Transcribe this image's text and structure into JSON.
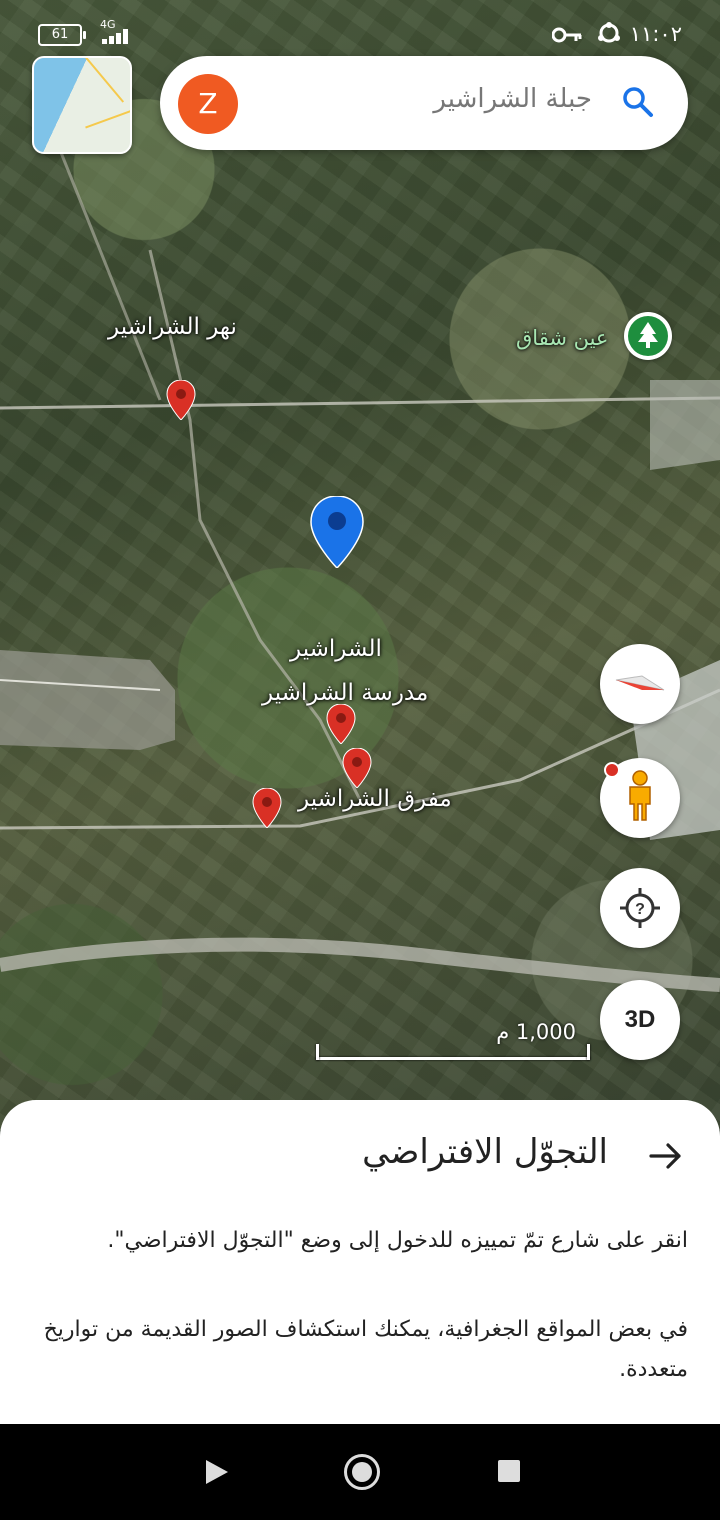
{
  "status_bar": {
    "battery": "61",
    "network": "4G",
    "time": "١١:٠٢"
  },
  "search": {
    "avatar_letter": "Z",
    "query": "جبلة الشراشير"
  },
  "map_labels": {
    "river": "نهر الشراشير",
    "spring": "عين شقاق",
    "village": "الشراشير",
    "school": "مدرسة الشراشير",
    "junction": "مفرق الشراشير"
  },
  "controls": {
    "mode_3d": "3D"
  },
  "scale": {
    "label": "1,000 م"
  },
  "sheet": {
    "title": "التجوّل الافتراضي",
    "paragraph1": "انقر على شارع تمّ تمييزه للدخول إلى وضع \"التجوّل الافتراضي\".",
    "paragraph2": "في بعض المواقع الجغرافية، يمكنك استكشاف الصور القديمة من تواريخ متعددة."
  },
  "colors": {
    "accent_blue": "#1a73e8",
    "pin_red": "#d93025",
    "avatar_orange": "#f05a22",
    "park_green": "#1e8e3e"
  }
}
